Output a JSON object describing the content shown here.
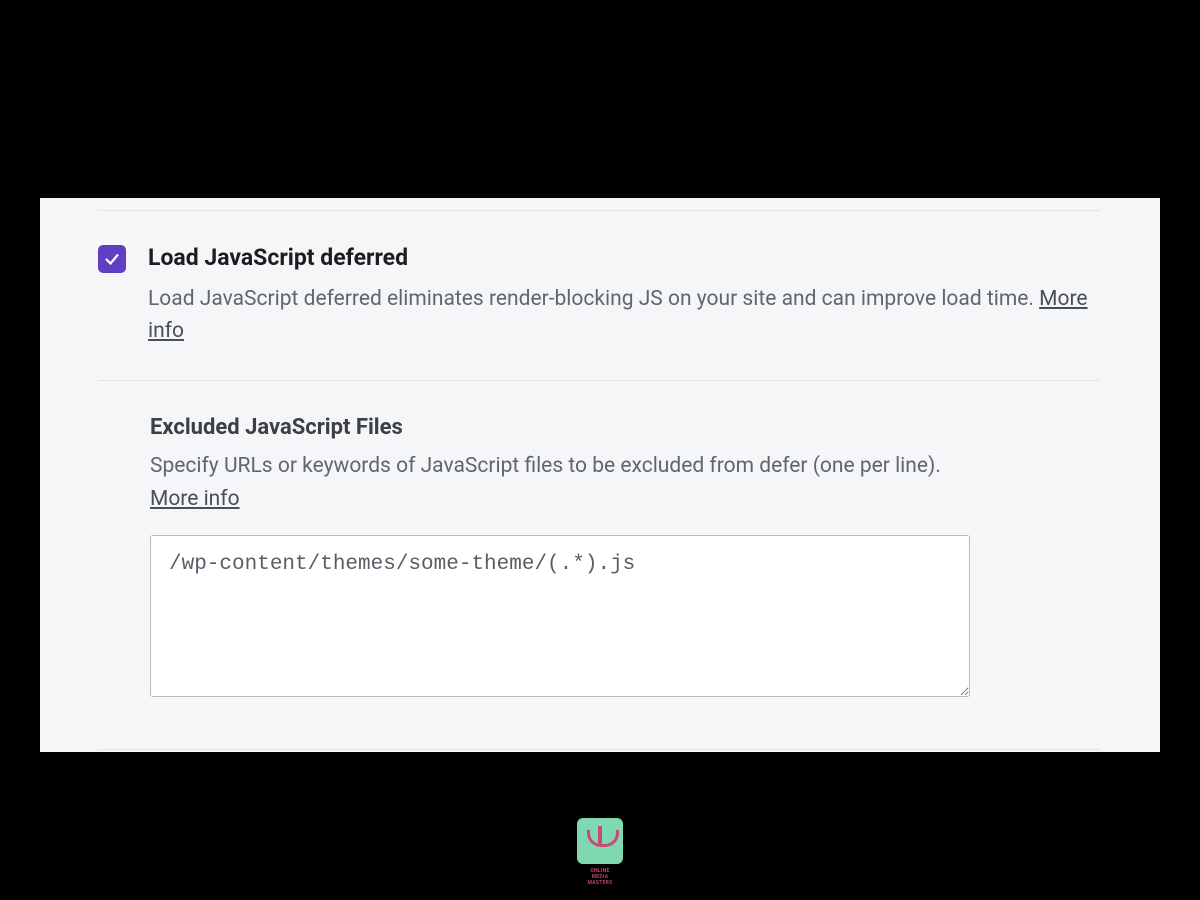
{
  "defer_option": {
    "title": "Load JavaScript deferred",
    "description": "Load JavaScript deferred eliminates render-blocking JS on your site and can improve load time. ",
    "more_info": "More info",
    "checked": true
  },
  "excluded": {
    "title": "Excluded JavaScript Files",
    "description": "Specify URLs or keywords of JavaScript files to be excluded from defer (one per line). ",
    "more_info": "More info",
    "textarea_value": "/wp-content/themes/some-theme/(.*).js"
  },
  "colors": {
    "accent": "#5f3fc4"
  }
}
